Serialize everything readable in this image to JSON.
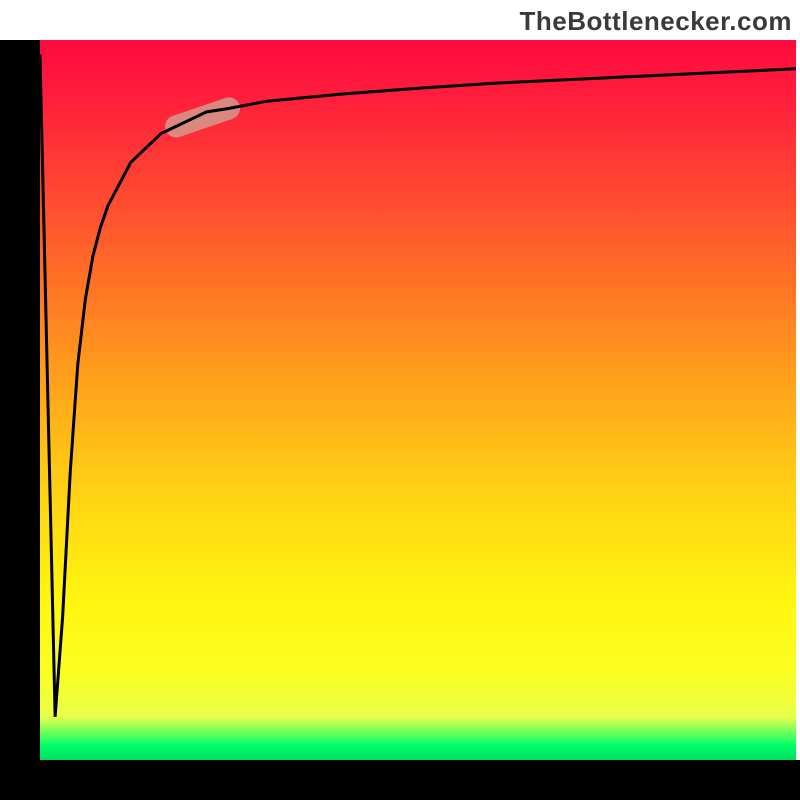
{
  "watermark": "TheBottlenecker.com",
  "colors": {
    "gradient_top": "#ff0a3e",
    "gradient_middle": "#fff60f",
    "gradient_bottom": "#00e060",
    "axis": "#000000",
    "curve": "#000000",
    "highlight": "#d29a8d"
  },
  "chart_data": {
    "type": "line",
    "title": "",
    "xlabel": "",
    "ylabel": "",
    "xlim": [
      0,
      100
    ],
    "ylim": [
      0,
      100
    ],
    "x": [
      0,
      2,
      3,
      4,
      5,
      6,
      7,
      8,
      9,
      10,
      11,
      12,
      13,
      14,
      15,
      16,
      18,
      20,
      22,
      25,
      30,
      35,
      40,
      50,
      60,
      70,
      80,
      90,
      100
    ],
    "values": [
      98,
      6,
      20,
      40,
      55,
      64,
      70,
      74,
      77,
      79,
      81,
      83,
      84,
      85,
      86,
      87,
      88,
      89,
      90,
      90.5,
      91.5,
      92,
      92.5,
      93.3,
      94,
      94.5,
      95,
      95.5,
      96
    ],
    "highlight_range_x": [
      18,
      25
    ],
    "grid": false,
    "legend": false,
    "notes": "Plot region has a vertical color gradient background (red→orange→yellow→green). Black filled bands serve as left and bottom axes. No numeric tick labels are visible. Values are estimated from pixel positions; the curve plunges from near the top to near the bottom at the extreme left, then rises asymptotically toward ~96. A soft pink capsule highlights the curve roughly over x≈18–25."
  }
}
